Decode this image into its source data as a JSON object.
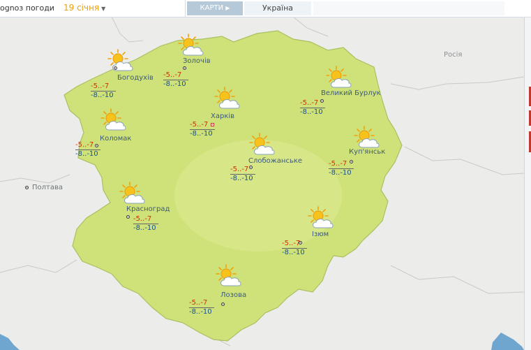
{
  "header": {
    "title": "ognoз погоди",
    "title_full": "Прогноз погоди",
    "date": "19 січня",
    "maps_tab": "КАРТИ",
    "country_tab": "Україна"
  },
  "neighbors": [
    {
      "name": "Росія"
    },
    {
      "name": "Полтава"
    }
  ],
  "icon_name": "sun-behind-cloud-icon",
  "colors": {
    "region_fill": "#cfe27a",
    "region_border": "#a9c060",
    "background": "#ececea",
    "max_temp": "#cc3300",
    "min_temp": "#1a4e8c",
    "city_label": "#3d5a78"
  },
  "cities": [
    {
      "name": "Богодухів",
      "max": "-5..-7",
      "min": "-8..-10"
    },
    {
      "name": "Золочів",
      "max": "-5..-7",
      "min": "-8..-10"
    },
    {
      "name": "Великий Бурлук",
      "max": "-5..-7",
      "min": "-8..-10"
    },
    {
      "name": "Харків",
      "max": "-5..-7",
      "min": "-8..-10"
    },
    {
      "name": "Коломак",
      "max": "-5..-7",
      "min": "-8..-10"
    },
    {
      "name": "Слобожанське",
      "max": "-5..-7",
      "min": "-8..-10"
    },
    {
      "name": "Куп'янськ",
      "max": "-5..-7",
      "min": "-8..-10"
    },
    {
      "name": "Красноград",
      "max": "-5..-7",
      "min": "-8..-10"
    },
    {
      "name": "Ізюм",
      "max": "-5..-7",
      "min": "-8..-10"
    },
    {
      "name": "Лозова",
      "max": "-5..-7",
      "min": "-8..-10"
    }
  ]
}
